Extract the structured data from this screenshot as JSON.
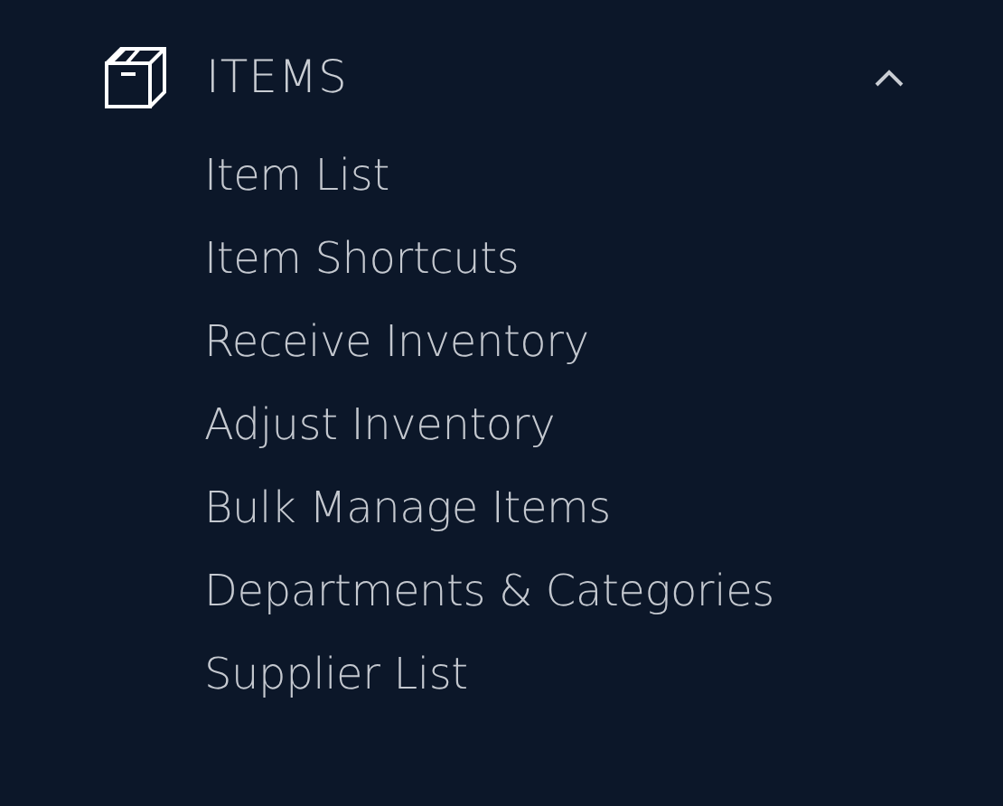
{
  "section": {
    "title": "ITEMS",
    "expanded": true
  },
  "items": [
    {
      "label": "Item List"
    },
    {
      "label": "Item Shortcuts"
    },
    {
      "label": "Receive Inventory"
    },
    {
      "label": "Adjust Inventory"
    },
    {
      "label": "Bulk Manage Items"
    },
    {
      "label": "Departments & Categories"
    },
    {
      "label": "Supplier List"
    }
  ]
}
